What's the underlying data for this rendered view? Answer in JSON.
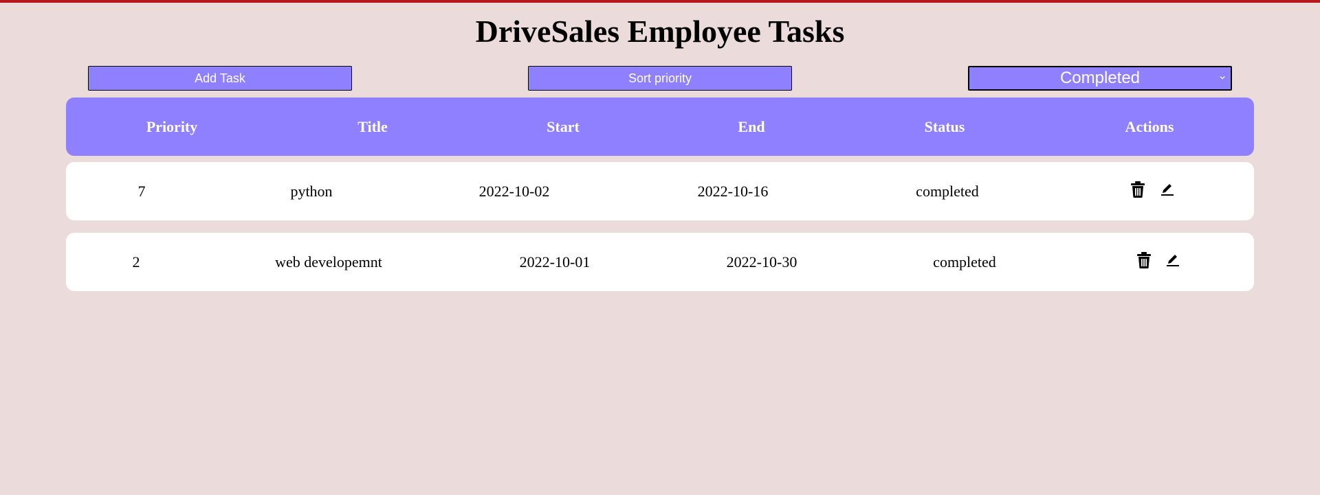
{
  "page": {
    "title": "DriveSales Employee Tasks"
  },
  "toolbar": {
    "add_task_label": "Add Task",
    "sort_priority_label": "Sort priority",
    "status_filter": {
      "selected": "Completed"
    }
  },
  "table": {
    "columns": [
      "Priority",
      "Title",
      "Start",
      "End",
      "Status",
      "Actions"
    ],
    "rows": [
      {
        "priority": "7",
        "title": "python",
        "start": "2022-10-02",
        "end": "2022-10-16",
        "status": "completed",
        "actions": [
          "trash-icon",
          "edit-icon"
        ]
      },
      {
        "priority": "2",
        "title": "web developemnt",
        "start": "2022-10-01",
        "end": "2022-10-30",
        "status": "completed",
        "actions": [
          "trash-icon",
          "edit-icon"
        ]
      }
    ]
  },
  "colors": {
    "background": "#ebdbdb",
    "accent": "#8f80ff",
    "top_bar": "#b5191c",
    "row_background": "#ffffff"
  }
}
